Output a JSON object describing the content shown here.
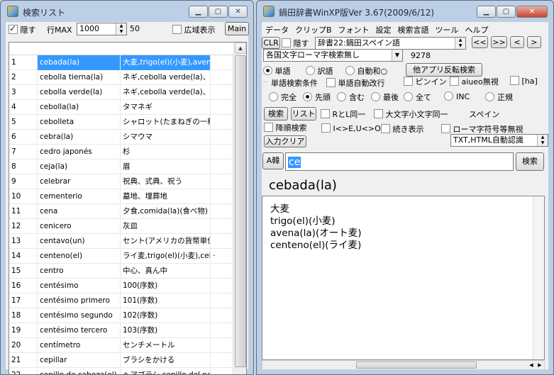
{
  "left_window": {
    "title": "検索リスト",
    "hide_label": "隠す",
    "row_max_label": "行MAX",
    "row_max_value": "1000",
    "count_label": "50",
    "wide_display_label": "広域表示",
    "main_button": "Main",
    "rows": [
      {
        "num": "1",
        "word": "cebada(la)",
        "meaning": "大麦,trigo(el)(小麦),avena(la)"
      },
      {
        "num": "2",
        "word": "cebolla tierna(la)",
        "meaning": "ネギ,cebolla verde(la)、cebolleta"
      },
      {
        "num": "3",
        "word": "cebolla verde(la)",
        "meaning": "ネギ,cebolla verde(la)、cebolleta"
      },
      {
        "num": "4",
        "word": "cebolla(la)",
        "meaning": "タマネギ"
      },
      {
        "num": "5",
        "word": "cebolleta",
        "meaning": "シャロット(たまねぎの一種)"
      },
      {
        "num": "6",
        "word": "cebra(la)",
        "meaning": "シマウマ"
      },
      {
        "num": "7",
        "word": "cedro japonés",
        "meaning": "杉"
      },
      {
        "num": "8",
        "word": "ceja(la)",
        "meaning": "眉"
      },
      {
        "num": "9",
        "word": "celebrar",
        "meaning": "祝典、式典、祝う"
      },
      {
        "num": "10",
        "word": "cementerio",
        "meaning": "墓地、埋葬地"
      },
      {
        "num": "11",
        "word": "cena",
        "meaning": "夕食,comida(la)(食べ物)"
      },
      {
        "num": "12",
        "word": "cenicero",
        "meaning": "灰皿"
      },
      {
        "num": "13",
        "word": "centavo(un)",
        "meaning": "セント(アメリカの貨幣単位)"
      },
      {
        "num": "14",
        "word": "centeno(el)",
        "meaning": "ライ麦,trigo(el)(小麦),cebada"
      },
      {
        "num": "15",
        "word": "centro",
        "meaning": "中心、真ん中"
      },
      {
        "num": "16",
        "word": "centésimo",
        "meaning": "100(序数)"
      },
      {
        "num": "17",
        "word": "centésimo primero",
        "meaning": "101(序数)"
      },
      {
        "num": "18",
        "word": "centésimo segundo",
        "meaning": "102(序数)"
      },
      {
        "num": "19",
        "word": "centésimo tercero",
        "meaning": "103(序数)"
      },
      {
        "num": "20",
        "word": "centímetro",
        "meaning": "センチメートル"
      },
      {
        "num": "21",
        "word": "cepillar",
        "meaning": "ブラシをかける"
      },
      {
        "num": "22",
        "word": "cepillo de cabeza(el)",
        "meaning": "ヘアブラシ,cepillo del pelo"
      }
    ],
    "row14_extra": "·"
  },
  "right_window": {
    "title": "鍋田辞書WinXP版Ver 3.67(2009/6/12)",
    "menu": [
      "データ",
      "クリップB",
      "フォント",
      "設定",
      "検索言語",
      "ツール",
      "ヘルプ"
    ],
    "clr_button": "CLR",
    "hide_label": "隠す",
    "dictionary_select": "辞書22:鍋田スペイン語",
    "nav_buttons": [
      "<<",
      ">>",
      "<",
      ">"
    ],
    "romaji_select": "各国文字ローマ字検索無し",
    "count": "9278",
    "mode_radios": [
      {
        "label": "単語",
        "selected": true
      },
      {
        "label": "訳語",
        "selected": false
      },
      {
        "label": "自動和○",
        "selected": false
      }
    ],
    "reverse_button": "他アプリ反転検索",
    "condition_label": "単語検索条件",
    "auto_newline_label": "単語自動改行",
    "pinyin_label": "ピンイン",
    "aiueo_label": "aiueo無視",
    "ha_label": "[ha]",
    "match_radios": [
      {
        "label": "完全",
        "selected": false
      },
      {
        "label": "先頭",
        "selected": true
      },
      {
        "label": "含む",
        "selected": false
      },
      {
        "label": "最後",
        "selected": false
      },
      {
        "label": "全て",
        "selected": false
      },
      {
        "label": "INC",
        "selected": false
      },
      {
        "label": "正規",
        "selected": false
      }
    ],
    "search_button": "検索",
    "list_button": "リスト",
    "rl_same_label": "RとL同一",
    "case_same_label": "大文字小文字同一",
    "language_label": "スペイン",
    "reverse_order_label": "降順検索",
    "ke_label": "I<>E,U<>O",
    "continue_display_label": "続き表示",
    "romaji_ignore_label": "ローマ字符号等無視",
    "input_clear_button": "入力クリア",
    "encoding_select": "TXT,HTML自動認識",
    "a_kan_button": "A韓",
    "search_input_value": "ce",
    "search_go_button": "検索",
    "result_word": "cebada(la)",
    "result_lines": [
      "大麦",
      "trigo(el)(小麦)",
      "avena(la)(オート麦)",
      "centeno(el)(ライ麦)"
    ]
  }
}
